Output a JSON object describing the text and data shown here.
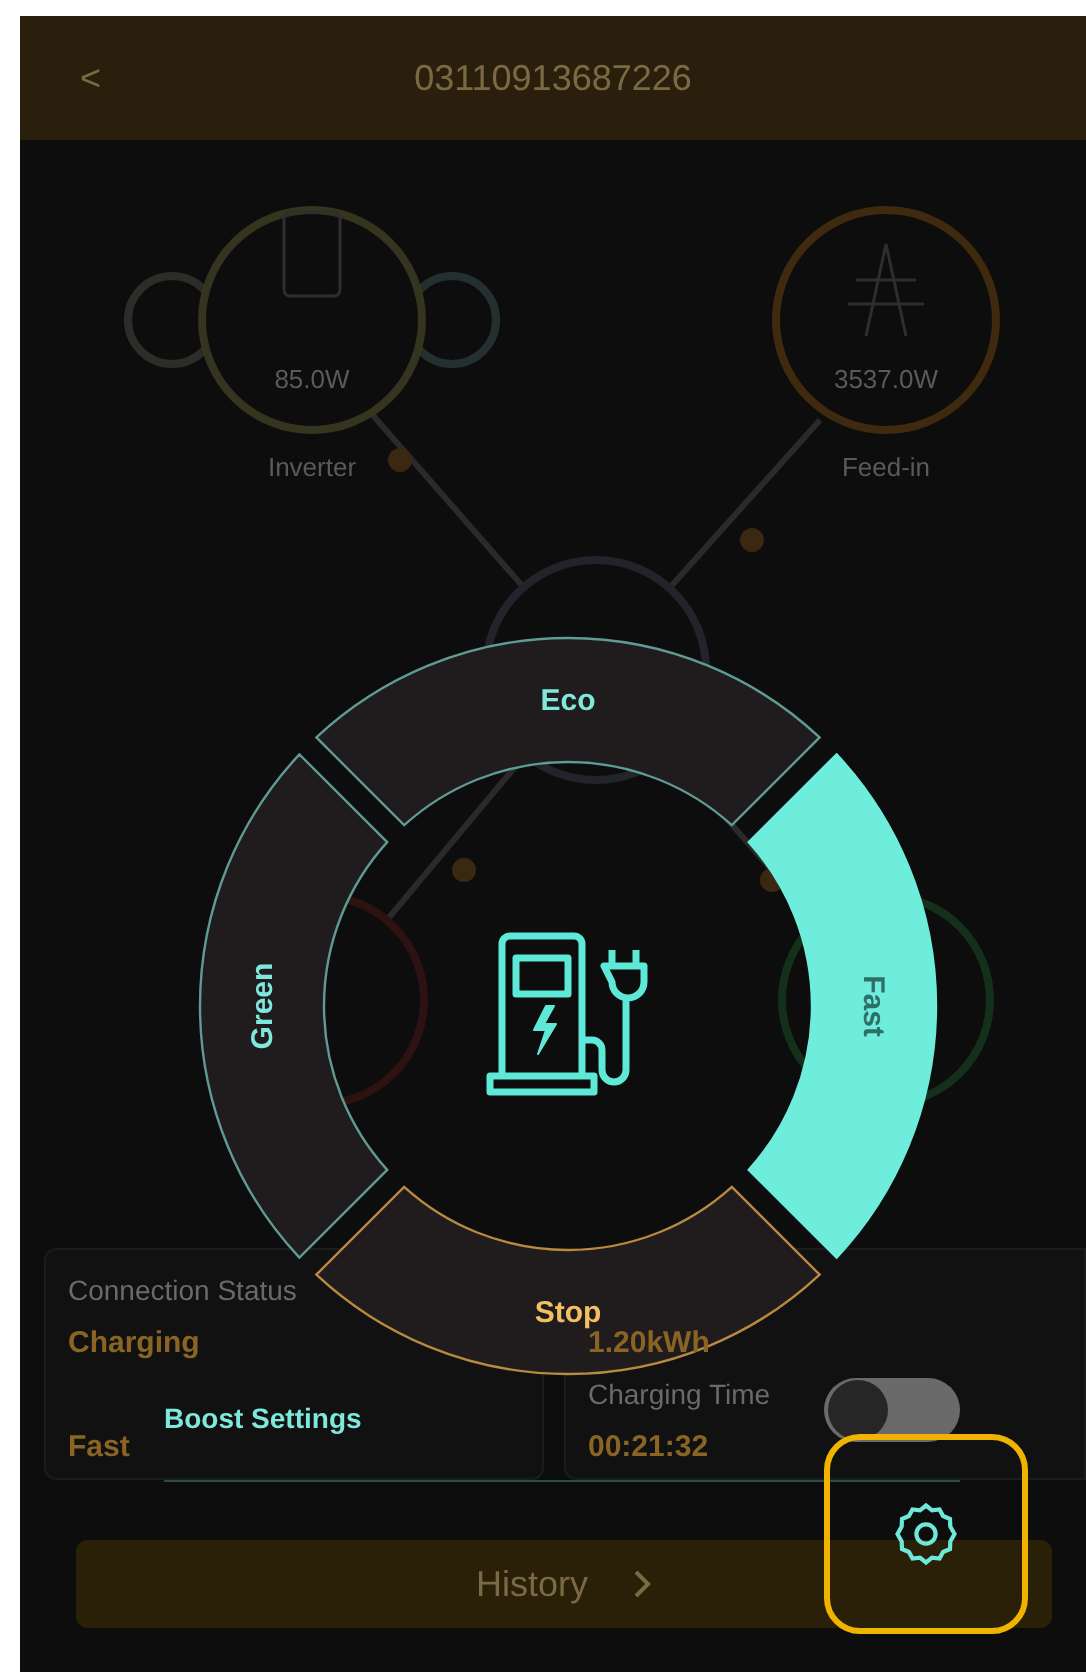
{
  "header": {
    "back": "<",
    "title": "03110913687226"
  },
  "flow": {
    "inverter": {
      "power": "85.0W",
      "label": "Inverter"
    },
    "grid": {
      "power": "3537.0W",
      "label": "Feed-in"
    }
  },
  "cards": [
    {
      "fields": [
        {
          "label": "Connection Status",
          "value": "Charging"
        },
        {
          "value": "Fast"
        }
      ]
    },
    {
      "fields": [
        {
          "value": "1.20kWh"
        },
        {
          "label": "Charging Time",
          "value": "00:21:32"
        }
      ]
    }
  ],
  "modes": [
    {
      "label": "Eco",
      "kind": "mode",
      "selected": false
    },
    {
      "label": "Fast",
      "kind": "mode",
      "selected": true
    },
    {
      "label": "Stop",
      "kind": "stop",
      "selected": false
    },
    {
      "label": "Green",
      "kind": "mode",
      "selected": false
    }
  ],
  "boost": {
    "label": "Boost Settings",
    "on": false
  },
  "settings_button": {
    "highlighted": true
  },
  "history": {
    "label": "History"
  }
}
